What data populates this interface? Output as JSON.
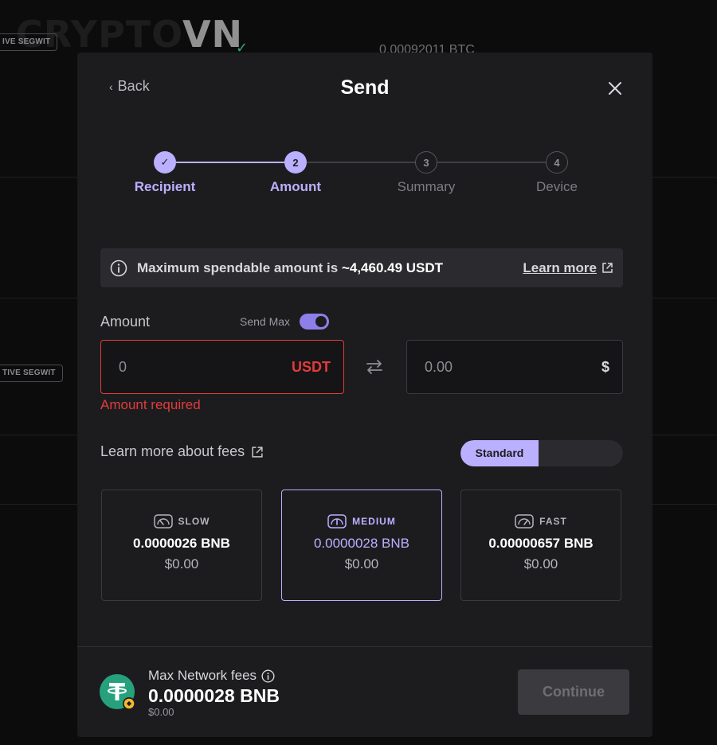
{
  "background": {
    "watermark_dim": "CRYPTO",
    "watermark_bright": "VN",
    "tag_1": "IVE SEGWIT",
    "tag_2": "TIVE SEGWIT",
    "btc_amount": "0.00092011 BTC"
  },
  "modal": {
    "back_label": "Back",
    "title": "Send"
  },
  "stepper": {
    "steps": [
      {
        "label": "Recipient",
        "number": "✓",
        "state": "done"
      },
      {
        "label": "Amount",
        "number": "2",
        "state": "active"
      },
      {
        "label": "Summary",
        "number": "3",
        "state": "todo"
      },
      {
        "label": "Device",
        "number": "4",
        "state": "todo"
      }
    ]
  },
  "banner": {
    "message": "Maximum spendable amount is ",
    "amount": "~4,460.49 USDT",
    "learn_more": "Learn more"
  },
  "amount": {
    "label": "Amount",
    "send_max_label": "Send Max",
    "send_max_on": true,
    "crypto_placeholder": "0",
    "crypto_unit": "USDT",
    "fiat_placeholder": "0.00",
    "fiat_unit": "$",
    "error": "Amount required"
  },
  "fees": {
    "learn_link": "Learn more about fees",
    "mode_selected": "Standard",
    "cards": [
      {
        "speed": "SLOW",
        "crypto": "0.0000026 BNB",
        "fiat": "$0.00",
        "selected": false
      },
      {
        "speed": "MEDIUM",
        "crypto": "0.0000028 BNB",
        "fiat": "$0.00",
        "selected": true
      },
      {
        "speed": "FAST",
        "crypto": "0.00000657 BNB",
        "fiat": "$0.00",
        "selected": false
      }
    ]
  },
  "footer": {
    "network_label": "Max Network fees",
    "network_amount": "0.0000028 BNB",
    "network_fiat": "$0.00",
    "continue_label": "Continue"
  },
  "colors": {
    "accent": "#bbb0ff",
    "error": "#e33b3b",
    "tether": "#26a17b",
    "bnb": "#f3ba2f"
  }
}
